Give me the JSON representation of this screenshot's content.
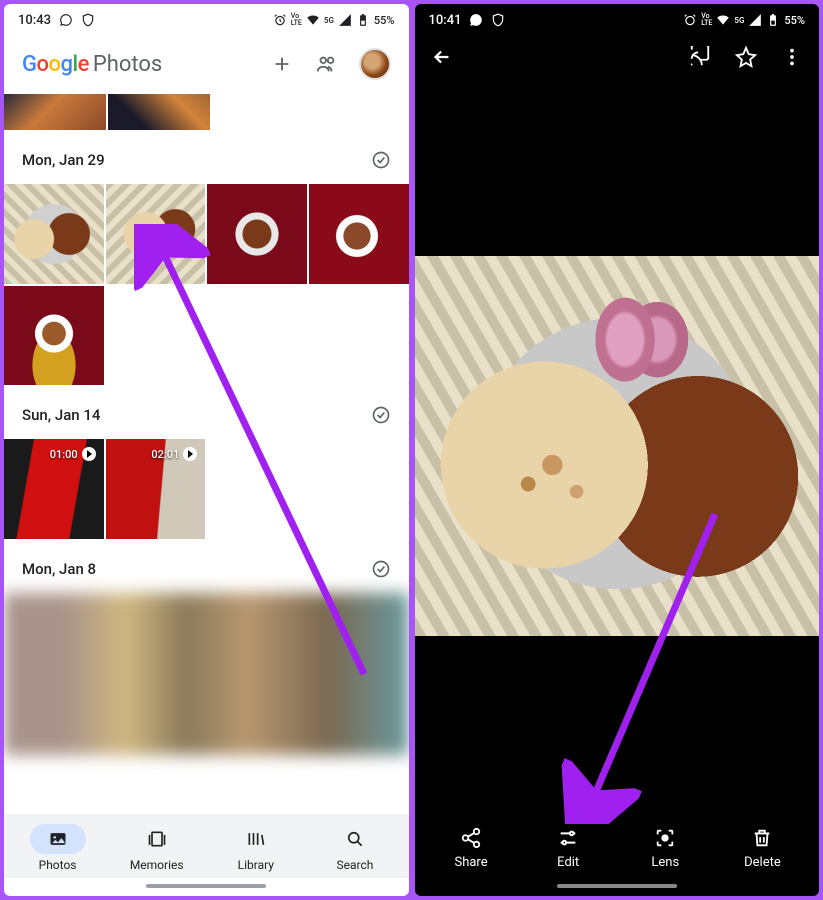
{
  "left_screen": {
    "status": {
      "time": "10:43",
      "battery_pct": "55%"
    },
    "app_title": {
      "google": "Google",
      "photos": "Photos"
    },
    "sections": [
      {
        "label": "Mon, Jan 29"
      },
      {
        "label": "Sun, Jan 14"
      },
      {
        "label": "Mon, Jan 8"
      }
    ],
    "videos": [
      {
        "duration": "01:00"
      },
      {
        "duration": "02:01"
      }
    ],
    "nav": {
      "photos": "Photos",
      "memories": "Memories",
      "library": "Library",
      "search": "Search"
    }
  },
  "right_screen": {
    "status": {
      "time": "10:41",
      "battery_pct": "55%"
    },
    "actions": {
      "share": "Share",
      "edit": "Edit",
      "lens": "Lens",
      "delete": "Delete"
    }
  }
}
